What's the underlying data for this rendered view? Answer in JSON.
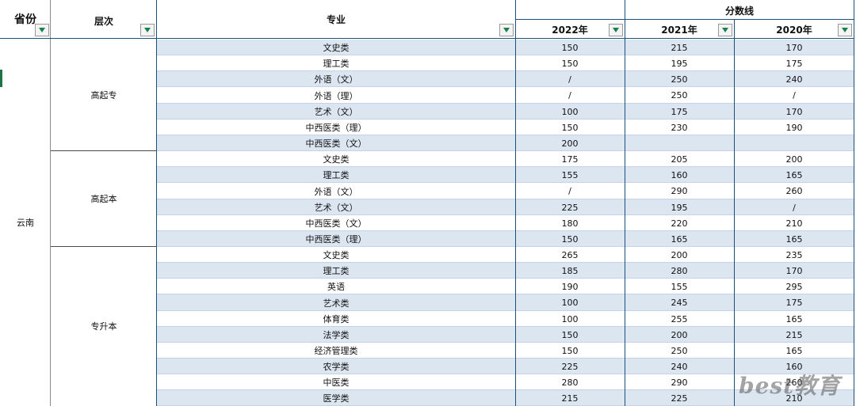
{
  "headers": {
    "province": "省份",
    "level": "层次",
    "major": "专业",
    "score_line": "分数线",
    "y2022": "2022年",
    "y2021": "2021年",
    "y2020": "2020年"
  },
  "province_value": "云南",
  "groups": [
    {
      "label": "高起专"
    },
    {
      "label": "高起本"
    },
    {
      "label": "专升本"
    }
  ],
  "rows": [
    {
      "major": "文史类",
      "y2022": "150",
      "y2021": "215",
      "y2020": "170"
    },
    {
      "major": "理工类",
      "y2022": "150",
      "y2021": "195",
      "y2020": "175"
    },
    {
      "major": "外语（文）",
      "y2022": "/",
      "y2021": "250",
      "y2020": "240"
    },
    {
      "major": "外语（理）",
      "y2022": "/",
      "y2021": "250",
      "y2020": "/"
    },
    {
      "major": "艺术（文）",
      "y2022": "100",
      "y2021": "175",
      "y2020": "170"
    },
    {
      "major": "中西医类（理）",
      "y2022": "150",
      "y2021": "230",
      "y2020": "190"
    },
    {
      "major": "中西医类（文）",
      "y2022": "200",
      "y2021": "",
      "y2020": ""
    },
    {
      "major": "文史类",
      "y2022": "175",
      "y2021": "205",
      "y2020": "200"
    },
    {
      "major": "理工类",
      "y2022": "155",
      "y2021": "160",
      "y2020": "165"
    },
    {
      "major": "外语（文）",
      "y2022": "/",
      "y2021": "290",
      "y2020": "260"
    },
    {
      "major": "艺术（文）",
      "y2022": "225",
      "y2021": "195",
      "y2020": "/"
    },
    {
      "major": "中西医类（文）",
      "y2022": "180",
      "y2021": "220",
      "y2020": "210"
    },
    {
      "major": "中西医类（理）",
      "y2022": "150",
      "y2021": "165",
      "y2020": "165"
    },
    {
      "major": "文史类",
      "y2022": "265",
      "y2021": "200",
      "y2020": "235"
    },
    {
      "major": "理工类",
      "y2022": "185",
      "y2021": "280",
      "y2020": "170"
    },
    {
      "major": "英语",
      "y2022": "190",
      "y2021": "155",
      "y2020": "295"
    },
    {
      "major": "艺术类",
      "y2022": "100",
      "y2021": "245",
      "y2020": "175"
    },
    {
      "major": "体育类",
      "y2022": "100",
      "y2021": "255",
      "y2020": "165"
    },
    {
      "major": "法学类",
      "y2022": "150",
      "y2021": "200",
      "y2020": "215"
    },
    {
      "major": "经济管理类",
      "y2022": "150",
      "y2021": "250",
      "y2020": "165"
    },
    {
      "major": "农学类",
      "y2022": "225",
      "y2021": "240",
      "y2020": "160"
    },
    {
      "major": "中医类",
      "y2022": "280",
      "y2021": "290",
      "y2020": "260"
    },
    {
      "major": "医学类",
      "y2022": "215",
      "y2021": "225",
      "y2020": "210"
    }
  ],
  "watermark": "best教育",
  "icons": {
    "filter": "filter-dropdown-icon"
  },
  "colors": {
    "band": "#dce6f1",
    "border": "#1f4e79",
    "filter_arrow": "#1a7f4b"
  }
}
